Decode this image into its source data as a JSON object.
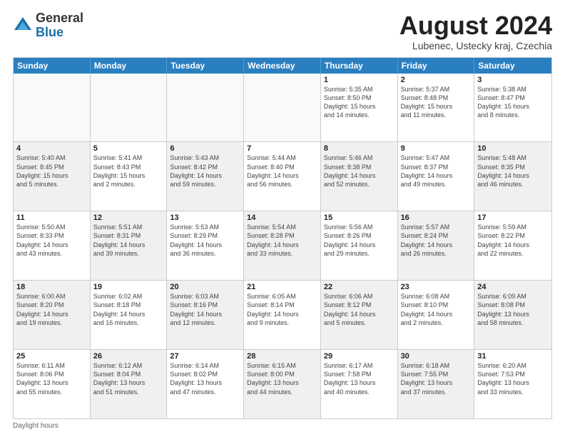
{
  "logo": {
    "general": "General",
    "blue": "Blue"
  },
  "title": "August 2024",
  "subtitle": "Lubenec, Ustecky kraj, Czechia",
  "header_days": [
    "Sunday",
    "Monday",
    "Tuesday",
    "Wednesday",
    "Thursday",
    "Friday",
    "Saturday"
  ],
  "rows": [
    [
      {
        "day": "",
        "info": "",
        "empty": true
      },
      {
        "day": "",
        "info": "",
        "empty": true
      },
      {
        "day": "",
        "info": "",
        "empty": true
      },
      {
        "day": "",
        "info": "",
        "empty": true
      },
      {
        "day": "1",
        "info": "Sunrise: 5:35 AM\nSunset: 8:50 PM\nDaylight: 15 hours\nand 14 minutes."
      },
      {
        "day": "2",
        "info": "Sunrise: 5:37 AM\nSunset: 8:48 PM\nDaylight: 15 hours\nand 11 minutes."
      },
      {
        "day": "3",
        "info": "Sunrise: 5:38 AM\nSunset: 8:47 PM\nDaylight: 15 hours\nand 8 minutes."
      }
    ],
    [
      {
        "day": "4",
        "info": "Sunrise: 5:40 AM\nSunset: 8:45 PM\nDaylight: 15 hours\nand 5 minutes.",
        "shaded": true
      },
      {
        "day": "5",
        "info": "Sunrise: 5:41 AM\nSunset: 8:43 PM\nDaylight: 15 hours\nand 2 minutes."
      },
      {
        "day": "6",
        "info": "Sunrise: 5:43 AM\nSunset: 8:42 PM\nDaylight: 14 hours\nand 59 minutes.",
        "shaded": true
      },
      {
        "day": "7",
        "info": "Sunrise: 5:44 AM\nSunset: 8:40 PM\nDaylight: 14 hours\nand 56 minutes."
      },
      {
        "day": "8",
        "info": "Sunrise: 5:46 AM\nSunset: 8:38 PM\nDaylight: 14 hours\nand 52 minutes.",
        "shaded": true
      },
      {
        "day": "9",
        "info": "Sunrise: 5:47 AM\nSunset: 8:37 PM\nDaylight: 14 hours\nand 49 minutes."
      },
      {
        "day": "10",
        "info": "Sunrise: 5:48 AM\nSunset: 8:35 PM\nDaylight: 14 hours\nand 46 minutes.",
        "shaded": true
      }
    ],
    [
      {
        "day": "11",
        "info": "Sunrise: 5:50 AM\nSunset: 8:33 PM\nDaylight: 14 hours\nand 43 minutes."
      },
      {
        "day": "12",
        "info": "Sunrise: 5:51 AM\nSunset: 8:31 PM\nDaylight: 14 hours\nand 39 minutes.",
        "shaded": true
      },
      {
        "day": "13",
        "info": "Sunrise: 5:53 AM\nSunset: 8:29 PM\nDaylight: 14 hours\nand 36 minutes."
      },
      {
        "day": "14",
        "info": "Sunrise: 5:54 AM\nSunset: 8:28 PM\nDaylight: 14 hours\nand 33 minutes.",
        "shaded": true
      },
      {
        "day": "15",
        "info": "Sunrise: 5:56 AM\nSunset: 8:26 PM\nDaylight: 14 hours\nand 29 minutes."
      },
      {
        "day": "16",
        "info": "Sunrise: 5:57 AM\nSunset: 8:24 PM\nDaylight: 14 hours\nand 26 minutes.",
        "shaded": true
      },
      {
        "day": "17",
        "info": "Sunrise: 5:59 AM\nSunset: 8:22 PM\nDaylight: 14 hours\nand 22 minutes."
      }
    ],
    [
      {
        "day": "18",
        "info": "Sunrise: 6:00 AM\nSunset: 8:20 PM\nDaylight: 14 hours\nand 19 minutes.",
        "shaded": true
      },
      {
        "day": "19",
        "info": "Sunrise: 6:02 AM\nSunset: 8:18 PM\nDaylight: 14 hours\nand 16 minutes."
      },
      {
        "day": "20",
        "info": "Sunrise: 6:03 AM\nSunset: 8:16 PM\nDaylight: 14 hours\nand 12 minutes.",
        "shaded": true
      },
      {
        "day": "21",
        "info": "Sunrise: 6:05 AM\nSunset: 8:14 PM\nDaylight: 14 hours\nand 9 minutes."
      },
      {
        "day": "22",
        "info": "Sunrise: 6:06 AM\nSunset: 8:12 PM\nDaylight: 14 hours\nand 5 minutes.",
        "shaded": true
      },
      {
        "day": "23",
        "info": "Sunrise: 6:08 AM\nSunset: 8:10 PM\nDaylight: 14 hours\nand 2 minutes."
      },
      {
        "day": "24",
        "info": "Sunrise: 6:09 AM\nSunset: 8:08 PM\nDaylight: 13 hours\nand 58 minutes.",
        "shaded": true
      }
    ],
    [
      {
        "day": "25",
        "info": "Sunrise: 6:11 AM\nSunset: 8:06 PM\nDaylight: 13 hours\nand 55 minutes."
      },
      {
        "day": "26",
        "info": "Sunrise: 6:12 AM\nSunset: 8:04 PM\nDaylight: 13 hours\nand 51 minutes.",
        "shaded": true
      },
      {
        "day": "27",
        "info": "Sunrise: 6:14 AM\nSunset: 8:02 PM\nDaylight: 13 hours\nand 47 minutes."
      },
      {
        "day": "28",
        "info": "Sunrise: 6:15 AM\nSunset: 8:00 PM\nDaylight: 13 hours\nand 44 minutes.",
        "shaded": true
      },
      {
        "day": "29",
        "info": "Sunrise: 6:17 AM\nSunset: 7:58 PM\nDaylight: 13 hours\nand 40 minutes."
      },
      {
        "day": "30",
        "info": "Sunrise: 6:18 AM\nSunset: 7:55 PM\nDaylight: 13 hours\nand 37 minutes.",
        "shaded": true
      },
      {
        "day": "31",
        "info": "Sunrise: 6:20 AM\nSunset: 7:53 PM\nDaylight: 13 hours\nand 33 minutes."
      }
    ]
  ],
  "footer": "Daylight hours"
}
